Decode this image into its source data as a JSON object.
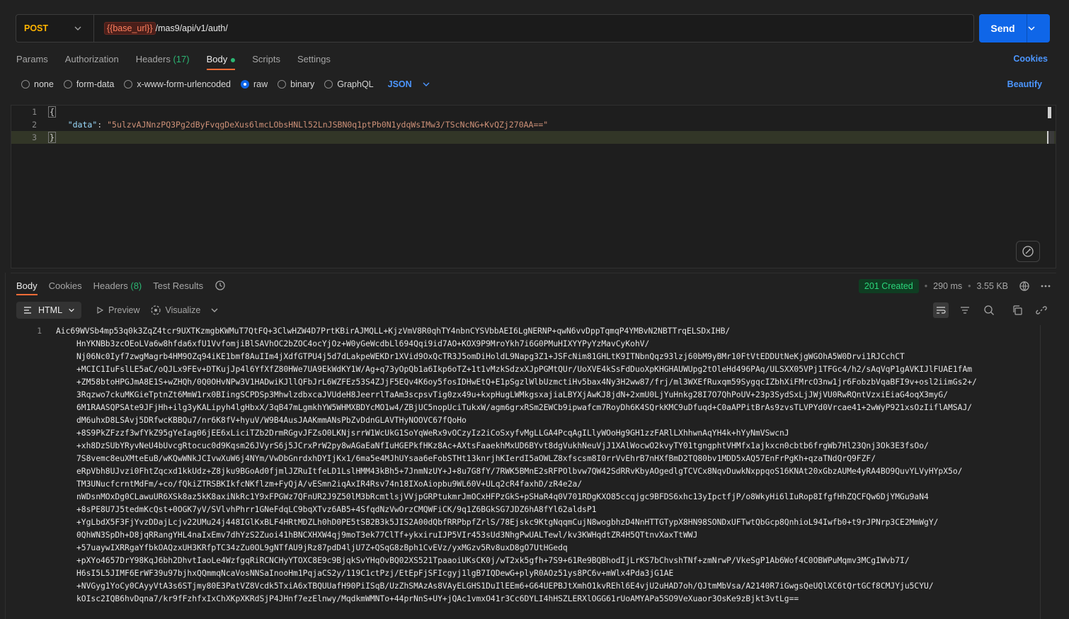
{
  "request": {
    "method": "POST",
    "url_var": "{{base_url}}",
    "url_path": "/mas9/api/v1/auth/",
    "send_label": "Send"
  },
  "tabs": [
    {
      "label": "Params"
    },
    {
      "label": "Authorization"
    },
    {
      "label": "Headers",
      "count": "(17)"
    },
    {
      "label": "Body"
    },
    {
      "label": "Scripts"
    },
    {
      "label": "Settings"
    }
  ],
  "cookies_label": "Cookies",
  "body_types": [
    "none",
    "form-data",
    "x-www-form-urlencoded",
    "raw",
    "binary",
    "GraphQL"
  ],
  "body_lang": "JSON",
  "beautify_label": "Beautify",
  "editor": {
    "line_numbers": [
      "1",
      "2",
      "3"
    ],
    "open_brace": "{",
    "key": "\"data\"",
    "colon": ": ",
    "value": "\"5ulzvAJNnzPQ3Pg2dByFvqgDeXus6lmcLObsHNLl52LnJSBN0q1ptPb0N1ydqWsIMw3/TScNcNG+KvQZj270AA==\"",
    "close_brace": "}"
  },
  "response": {
    "tabs": [
      {
        "label": "Body"
      },
      {
        "label": "Cookies"
      },
      {
        "label": "Headers",
        "count": "(8)"
      },
      {
        "label": "Test Results"
      }
    ],
    "status": "201 Created",
    "time": "290 ms",
    "size": "3.55 KB",
    "view_mode": "HTML",
    "preview_label": "Preview",
    "visualize_label": "Visualize",
    "line_number": "1",
    "lines": [
      "Aic69WVSb4mp53q0k3ZqZ4tcr9UXTKzmgbKWMuT7QtFQ+3ClwHZW4D7PrtKBirAJMQLL+KjzVmV8R0qhTY4nbnCYSVbbAEI6LgNERNP+qwN6vvDppTqmqP4YMBvN2NBTTrqELSDxIHB/",
      "HnYKNBb3zcOEoLVa6w8hfda6xfU1VvfomjiBlSAVhOC2bZOC4ocYjOz+W0yGeWcdbLl694Qqi9id7AO+KOX9P9MroYkh7i6G0PMuHIXYYPyYzMavCyKohV/",
      "Nj06Nc0Iyf7zwgMagrb4HM9OZq94iKE1bmf8AuIIm4jXdfGTPU4j5d7dLakpeWEKDr1XVid9OxQcTR3J5omDiHoldL9Napg3Z1+JSFcNim81GHLtK9ITNbnQqz93lzj60bM9yBMr10FtVtEDDUtNeKjgWGOhA5W0Drvi1RJCchCT",
      "+MCIC1IuFslLE5aC/oQJLx9FEv+DTKujJp4l6YfXfZ80HWe7UA9EkWdKY1W/Ag+q73yOpQb1a6Ikp6oTZ+1t1vMzkSdzxXJpPGMtQUr/UoXVE4kSsFdDuoXpKHGHAUWUpg2tOleHd496PAq/ULSXX05VPj1TFGc4/h2/sAqVqP1gAVKIJlFUAE1fAm",
      "+ZM58btoHPGJmA8E1S+wZHQh/0Q0OHvNPw3V1HADwiKJllQFbJrL6WZFEz53S4ZJjF5EQv4K6oy5fosIDHwEtQ+E1pSgzlWlbUzmctiHv5bax4Ny3H2ww87/frj/ml3WXEfRuxqm59SygqcIZbhXiFMrcO3nw1jr6FobzbVqaBFI9v+osl2iimGs2+/",
      "3Rqzwo7ckuMKGieTptnZt6MmW1rx0BIingSCPDSp3MhwlzdbxcaJVUdeH8JeerrlTaAm3scpsvTig0zx49u+kxpHugLWMkgsxajiaLBYXjAwKJ8jdN+2xmU0LjYuHnkg28I7O7QhPoUV+23p3SydSxLjJWjVU0RwRQntVzxiEiaG4oqX3myG/",
      "6M1RAASQPSAte9JFjHh+ilg3yKALipyh4lgHbxX/3qB47mLgmkhYW5WHMXBDYcMO1w4/ZBjUC5nopUciTukxW/agm6grxRSm2EWCb9ipwafcm7RoyDh6K4SQrkKMC9uDfuqd+C0aAPPitBrAs9zvsTLVPYd0Vrcae41+2wWyP921xsOzIiflAMSAJ/",
      "dM6uhxD8LSAvj5DRfwcKBBQu7/nr6K8fV+hyuV/W9B4AusJAAKmmANsPbZvDdnGLAVTHyNOOVC67fQoHo",
      "+8S9PkZFzzf3wfYkZ95gYeIag06jEE6xLiciTZb2DrmRGgvJFZsO0LKNjsrrW1WcUkG1SoYqWeRx9vOCzyIz2iCoSxyfvMgLLGA4PcqAgILlyWOoHg9GH1zzFARlLXhhwnAqYH4k+hYyNmVSwcnJ",
      "+xh8DzSUbYRyvNeU4bUvcgRtocuc0d9Kqsm26JVyrS6j5JCrxPrW2py8wAGaEaNfIuHGEPkfHKz8Ac+AXtsFaaekhMxUD6BYvt8dgVukhNeuVjJ1XAlWocwO2kvyTY01tgngphtVHMfx1ajkxcn0cbtb6frgWb7Hl23Qnj3Ok3E3fsOo/",
      "7S8vemc8euXMteEuB/wKQwWNkJCIvwXuW6j4NYm/VwDbGnrdxhDYIjKx1/6ma5e4MJhUYsaa6eFobSTHt13knrjhKIerdI5aOWLZ8xfscsm8I0rrVvEhrB7nHXfBmD2TQ80bv1MDD5xAQ57EnFrPgKh+qzaTNdQrQ9FZF/",
      "eRpVbh8UJvzi0FhtZqcxd1kkUdz+Z8jku9BGoAd0fjmlJZRuItfeLD1LslHMM43kBh5+7JnmNzUY+J+8u7G8fY/7RWK5BMnE2sRFPOlbvw7QW42SdRRvKbyAOgedlgTCVCx8NqvDuwkNxppqoS16KNAt20xGbzAUMe4yRA4BO9QuvYLVyHYpX5o/",
      "TM3UNucfcrntMdFm/+co/fQkiZTRSBKIkfcNKflzm+FyQjA/vESmn2iqAxIR4Rsv74n18IXoAiopbu9WL60V+ULq2cR4faxhD/zR4e2a/",
      "nWDsnMOxDg0CLawuUR6XSk8az5kK8axiNkRc1Y9xFPGWz7QFnUR2J9Z50lM3bRcmtlsjVVjpGRPtukmrJmOCxHFPzGkS+pSHaR4q0V701RDgKXO85ccqjgc9BFDS6xhc13yIpctfjP/o8WkyHi6lIuRop8IfgfHhZQCFQw6DjYMGu9aN4",
      "+8sPE8U7J5tedmKcQst+0OGK7yV/SVlvhPhrr1GNeFdqLC9bqXTvz6AB5+4SfqdNzVwOrzCMQWFiCK/9q1Z6BGkSG7JDZ6hA8fYl62aldsP1",
      "+YgLbdX5F3FjYvzDDajLcjv22UMu24j448IGlKxBLF4HRtMDZLh0hD0PE5tSB2B3k5JIS2A00dQbfRRPbpfZrlS/78Ejskc9KtgNqqmCujN8wogbhzD4NnHTTGTypX8HN98SONDxUFTwtQbGcp8QnhioL94Iwfb0+t9rJPNrp3CE2MmWgY/",
      "0QhWN3SpDh+D8jqRRangYHL4naIxEmv7dhYzS2Zuoi41hBNCXHXW4qj9moT3ek77ClTf+ykxiruIJP5VIr453sUd3NhgPwUALTewl/kv3KWHqdtZR4H5QTtnvXaxTtWWJ",
      "+57uaywIXRRgaYfbkOAQzxUH3KRfpTC34zZu0OL9gNTfAU9jRz87pdD4ljU7Z+QSqG8zBph1CvEVz/yxMGzv5Rv8uxD8gO7UtHGedq",
      "+pXYo4657DrY98KqJ6bh2DhvtIaoLe4WzfgqRiRCNCHyYTOXC8E9c9BjqkSvYHqOvBQ02XS521TpaaoiUKsCK0j/wT2xk5gfh+7S9+61Re9BQBhodIjLrKS7bChvshTNf+zmNrwP/VkeSgP1Ab6Wof4C0OBWPuMqmv3MCgIWvb7I/",
      "H6sI5L5JIMF6ErWF39u97bjhxQQmmqNcaVosNNSaInooHm1PqjaCS2y/119C1ctPzj/EtEpFjSFIcgyj1lgB7IQDewG+plyR0AOz51ys8PC6v+mWlx4Pda3jG1AE",
      "+NVGyg1YoCy0CAyyVtA3s6STjmy80E3PatVZ8Vcdk5TxiA6xTBQUUafH90PiISqB/UzZhSMAzAs8VAyELGHS1DuIlEEm6+G64UEPBJtXmhO1kvREhl6E4vjU2uHAD7oh/QJtmMbVsa/A2140R7iGwgsQeUQlXC6tQrtGCf8CMJYju5CYU/",
      "kOIsc2IQB6hvDqna7/kr9fFzhfxIxChXKpXKRdSjP4JHnf7ezElnwy/MqdkmWMNTo+44prNnS+UY+jQAc1vmxO41r3Cc6DYLI4hHSZLERXlOGG61rUoAMYAPa5SO9VeXuaor3OsKe9zBjkt3vtLg=="
    ]
  }
}
